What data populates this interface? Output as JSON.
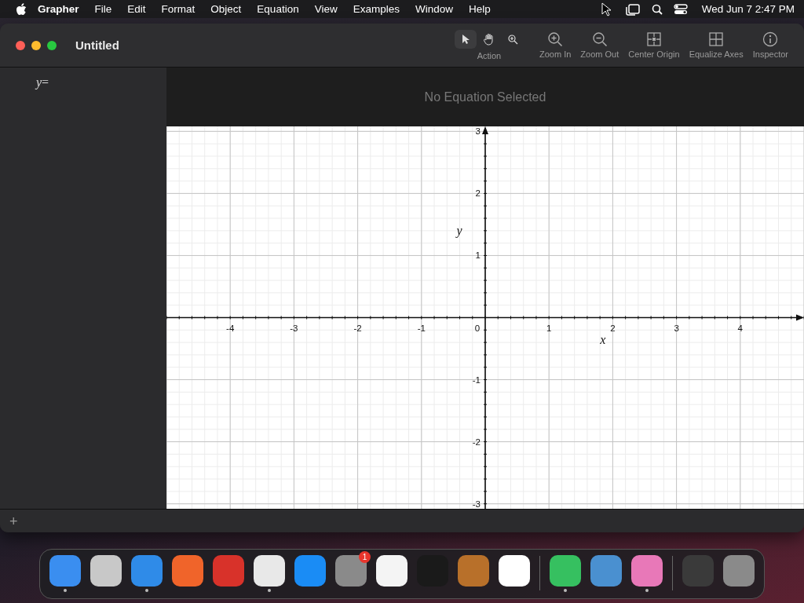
{
  "menu_bar": {
    "app": "Grapher",
    "items": [
      "File",
      "Edit",
      "Format",
      "Object",
      "Equation",
      "View",
      "Examples",
      "Window",
      "Help"
    ],
    "clock": "Wed Jun 7  2:47 PM"
  },
  "window": {
    "title": "Untitled",
    "toolbar": {
      "tools": [
        {
          "kind": "pointer",
          "selected": true
        },
        {
          "kind": "hand",
          "selected": false
        },
        {
          "kind": "magnifier",
          "selected": false
        }
      ],
      "tools_label": "Action",
      "buttons": [
        {
          "kind": "zoom-in",
          "label": "Zoom In"
        },
        {
          "kind": "zoom-out",
          "label": "Zoom Out"
        },
        {
          "kind": "center",
          "label": "Center Origin"
        },
        {
          "kind": "equalize",
          "label": "Equalize Axes"
        },
        {
          "kind": "info",
          "label": "Inspector"
        }
      ]
    },
    "sidebar": {
      "equation": "*y*="
    },
    "equation_header": "No Equation Selected",
    "graph": {
      "origin_label": "0",
      "chart_data": {
        "type": "line",
        "xlabel": "x",
        "ylabel": "y",
        "xlim": [
          -5,
          5
        ],
        "ylim": [
          -3.08,
          3.08
        ],
        "grid": true,
        "xticks": [
          -4,
          -3,
          -2,
          -1,
          1,
          2,
          3,
          4
        ],
        "yticks": [
          -3,
          -2,
          -1,
          1,
          2,
          3
        ]
      }
    },
    "add_button": "+"
  },
  "dock": {
    "groups": [
      [
        {
          "color": "#3a8ef0",
          "running": true
        },
        {
          "color": "#c8c8c8",
          "running": false
        },
        {
          "color": "#2f8be8",
          "running": true
        },
        {
          "color": "#f0642a",
          "running": false
        },
        {
          "color": "#d8322a",
          "running": false
        },
        {
          "color": "#e8e8e8",
          "running": true
        },
        {
          "color": "#1a8cf5",
          "running": false
        },
        {
          "color": "#8a8a8a",
          "running": false,
          "badge": "1"
        },
        {
          "color": "#f4f4f4",
          "running": false
        },
        {
          "color": "#1a1a1a",
          "running": false
        },
        {
          "color": "#b8702a",
          "running": false
        },
        {
          "color": "#ffffff",
          "running": false
        }
      ],
      [
        {
          "color": "#36c060",
          "running": true
        },
        {
          "color": "#4a90d0",
          "running": false
        },
        {
          "color": "#e878b8",
          "running": true
        }
      ],
      [
        {
          "color": "#3a3a3a",
          "running": false
        },
        {
          "color": "#8a8a8a",
          "running": false
        }
      ]
    ]
  }
}
